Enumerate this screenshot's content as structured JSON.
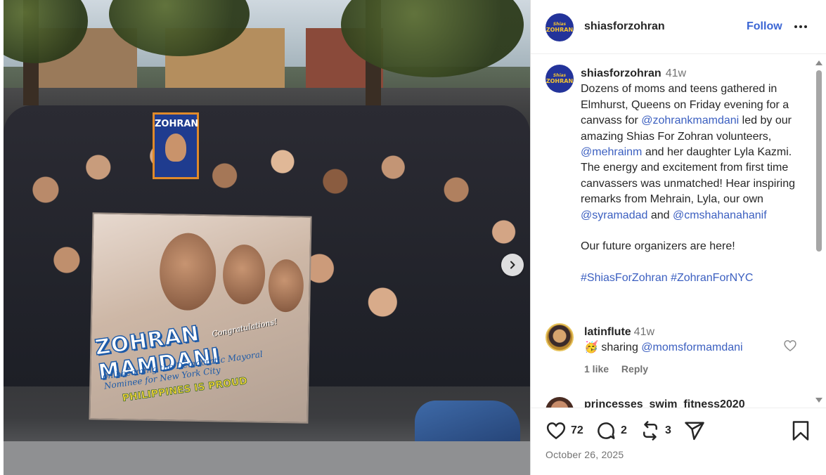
{
  "photo": {
    "sign_text": "ZOHRAN",
    "banner_title": "ZOHRAN MAMDANI",
    "banner_congrats": "Congratulations!",
    "banner_subtitle": "on becoming the Democratic Mayoral Nominee for New York City",
    "banner_footer": "PHILIPPINES IS PROUD"
  },
  "header": {
    "username": "shiasforzohran",
    "follow_label": "Follow",
    "avatar_line1": "Shias",
    "avatar_line2": "ZOHRAN"
  },
  "caption": {
    "username": "shiasforzohran",
    "time": "41w",
    "text_1": "Dozens of moms and teens gathered in Elmhurst, Queens on Friday evening for a canvass for ",
    "mention_1": "@zohrankmamdani",
    "text_2": " led by our amazing Shias For Zohran volunteers, ",
    "mention_2": "@mehrainm",
    "text_3": " and her daughter Lyla Kazmi. The energy and excitement from first time canvassers was unmatched! Hear inspiring remarks from Mehrain, Lyla, our own ",
    "mention_3": "@syramadad",
    "text_4": " and ",
    "mention_4": "@cmshahanahanif",
    "para_2": "Our future organizers are here!",
    "tag_1": "#ShiasForZohran",
    "tag_2": "#ZohranForNYC"
  },
  "comments": [
    {
      "username": "latinflute",
      "time": "41w",
      "emoji": "🥳",
      "text": " sharing ",
      "mention": "@momsformamdani",
      "likes": "1 like",
      "reply_label": "Reply"
    },
    {
      "username": "princesses_swim_fitness2020"
    }
  ],
  "actions": {
    "likes_count": "72",
    "comments_count": "2",
    "reposts_count": "3",
    "date": "October 26, 2025"
  },
  "colors": {
    "accent_link": "#3b5fc0",
    "follow": "#3b66d4",
    "avatar_bg": "#23339a",
    "avatar_text": "#f4c430"
  },
  "icons": {
    "like": "heart-icon",
    "comment": "comment-bubble-icon",
    "repost": "repost-icon",
    "share": "send-icon",
    "save": "bookmark-icon",
    "more": "more-horizontal-icon",
    "next": "chevron-right-icon"
  }
}
